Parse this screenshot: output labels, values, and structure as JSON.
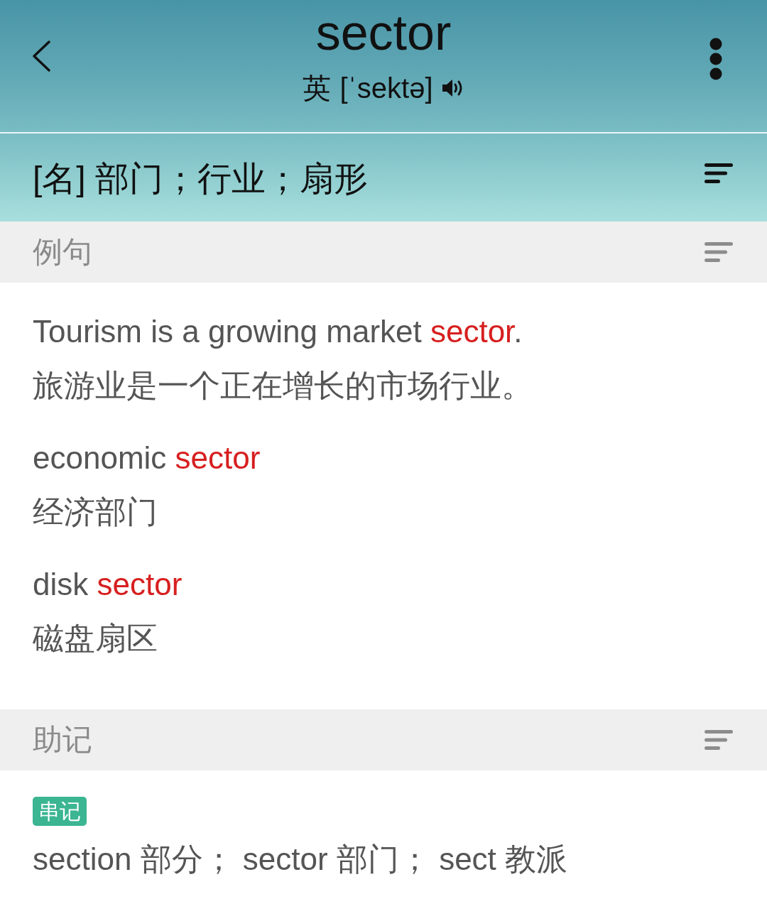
{
  "header": {
    "word": "sector",
    "region": "英",
    "phonetic": "[ˈsektə]"
  },
  "definition": "[名] 部门；行业；扇形",
  "sections": [
    {
      "kind": "examples",
      "title": "例句",
      "examples": [
        {
          "en": "Tourism is a growing market **sector**.",
          "zh": "旅游业是一个正在增长的市场行业。"
        },
        {
          "en": "economic **sector**",
          "zh": "经济部门"
        },
        {
          "en": "disk **sector**",
          "zh": "磁盘扇区"
        }
      ]
    },
    {
      "kind": "mnemonic",
      "title": "助记",
      "tag": "串记",
      "text": "section 部分； sector 部门； sect 教派"
    }
  ]
}
